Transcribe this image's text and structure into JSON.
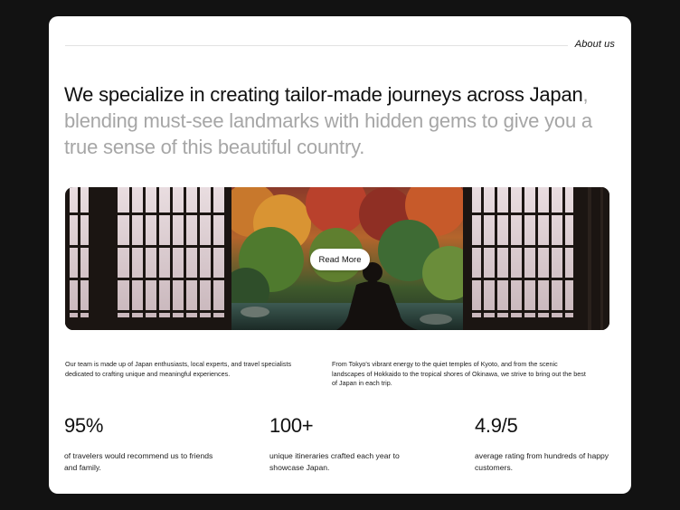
{
  "header": {
    "section_label": "About us"
  },
  "headline": {
    "dark_text": "We specialize in creating tailor-made journeys across Japan",
    "light_text": ", blending must-see landmarks with hidden gems to give you a true sense of this beautiful country."
  },
  "hero": {
    "read_more_label": "Read More"
  },
  "intro": {
    "left_text": "Our team is made up of Japan enthusiasts, local experts, and travel specialists dedicated to crafting unique and meaningful experiences.",
    "right_text": "From Tokyo's vibrant energy to the quiet temples of Kyoto, and from the scenic landscapes of Hokkaido to the tropical shores of Okinawa, we strive to bring out the best of Japan in each trip."
  },
  "stats": [
    {
      "value": "95%",
      "description": "of travelers would recommend us to friends and family."
    },
    {
      "value": "100+",
      "description": "unique itineraries crafted each year to showcase Japan."
    },
    {
      "value": "4.9/5",
      "description": "average rating from hundreds of happy customers."
    }
  ],
  "colors": {
    "background": "#121212",
    "card": "#ffffff",
    "text_dark": "#111111",
    "text_muted": "#a6a6a6"
  }
}
